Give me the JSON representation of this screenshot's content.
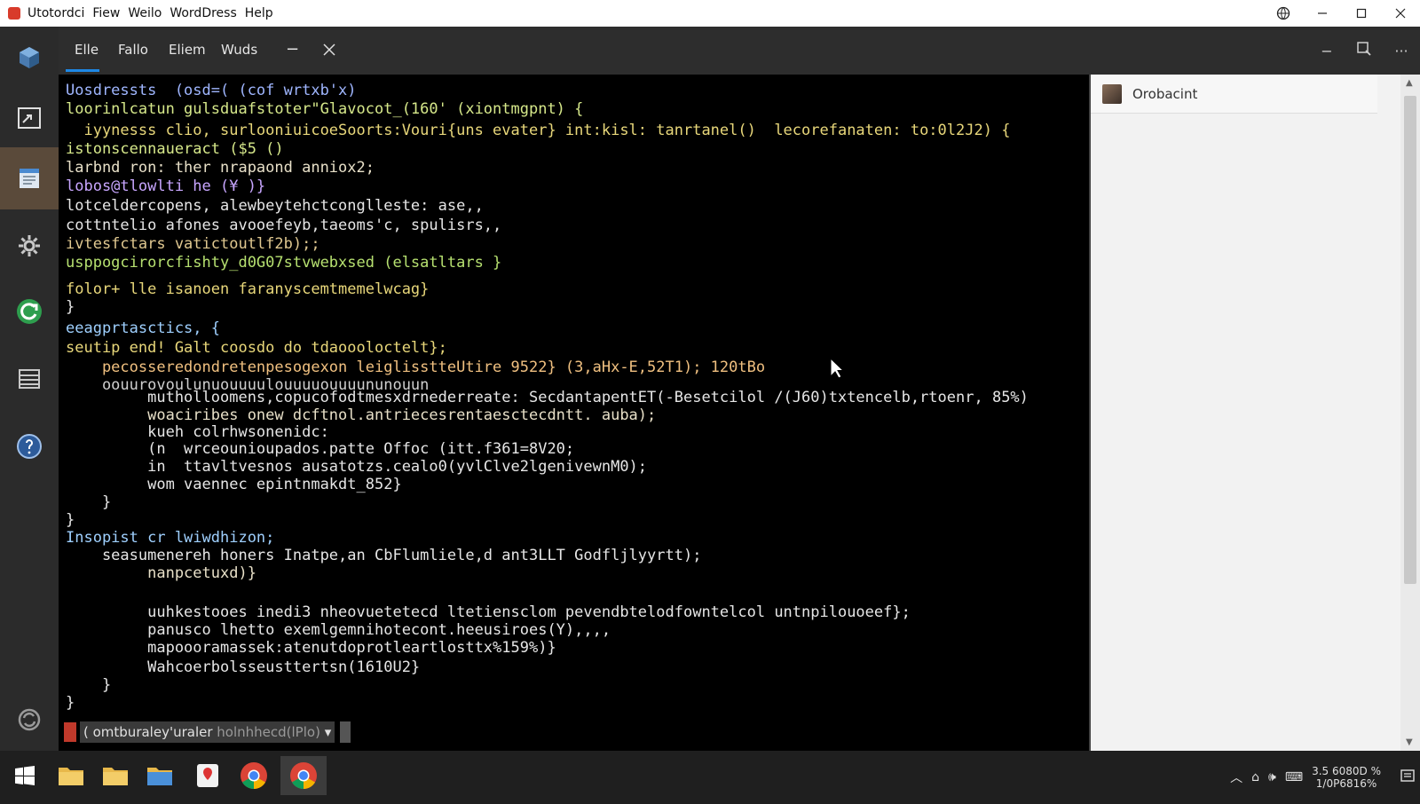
{
  "titlebar": {
    "menus": [
      "Utotordci",
      "Fiew",
      "Weilo",
      "WordDress",
      "Help"
    ]
  },
  "tabs": [
    {
      "label": "Elle"
    },
    {
      "label": "Fallo"
    },
    {
      "label": "Eliem"
    },
    {
      "label": "Wuds"
    }
  ],
  "code": [
    {
      "text": "Uosdressts  (osd=( (cof wrtxb'x)",
      "color": "#9fb6ff"
    },
    {
      "text": "loorinlcatun gulsduafstoter\"Glavocot_(160' (xiontmgpnt) {",
      "color": "#d6e88a"
    },
    {
      "text": "  iyynesss clio, surlooniuicoeSoorts:Vouri{uns evater} int:kisl: tanrtanel()  lecorefanaten: to:0l2J2) {",
      "color": "#e8d77a"
    },
    {
      "text": "istonscennaueract ($5 ()",
      "color": "#d6e88a"
    },
    {
      "text": "larbnd ron: ther nrapaond anniox2;",
      "color": "#e8e0c8"
    },
    {
      "text": "lobos@tlowlti he (¥ )}",
      "color": "#c8a6ff"
    },
    {
      "text": "lotceldercopens, alewbeytehctconglleste: ase,,",
      "color": "#e6e6e6"
    },
    {
      "text": "cottntelio afones avooefeyb,taeoms'c, spulisrs,,",
      "color": "#e6e6e6"
    },
    {
      "text": "ivtesfctars vatictoutlf2b);;",
      "color": "#e0c890"
    },
    {
      "text": "usppogcirorcfishty_d0G07stvwebxsed (elsatltars }",
      "color": "#b6e070"
    },
    {
      "text": "folor+ lle isanoen faranyscemtmemelwcag}",
      "color": "#e8d77a"
    },
    {
      "text": "}",
      "color": "#e6e6e6"
    },
    {
      "text": "eeagprtasctics, {",
      "color": "#9fd0ff"
    },
    {
      "text": "seutip end! Galt coosdo do tdaoooloctelt};",
      "color": "#e8d77a"
    },
    {
      "text": "    pecosseredondretenpesogexon leiglisstteUtire 9522} (3,aHx-E,52T1); 120tBo",
      "color": "#f0c080"
    },
    {
      "text": "    oouurovoulunuouuuulouuuuouuuununouun",
      "color": "#cfcfcf"
    },
    {
      "text": "         mutholloomens,copucofodtmesxdrnederreate: SecdantapentET(-Besetcilol /(J60)txtencelb,rtoenr, 85%)",
      "color": "#e6e6e6"
    },
    {
      "text": "         woaciribes onew dcftnol.antriecesrentaesctecdntt. auba);",
      "color": "#e8e0c8"
    },
    {
      "text": "         kueh colrhwsonenidc:",
      "color": "#e6e6e6"
    },
    {
      "text": "         (n  wrceounioupados.patte Offoc (itt.f361=8V20;",
      "color": "#e6e6e6"
    },
    {
      "text": "         in  ttavltvesnos ausatotzs.cealo0(yvlClve2lgenivewnM0);",
      "color": "#e6e6e6"
    },
    {
      "text": "         wom vaennec epintnmakdt_852}",
      "color": "#e6e6e6"
    },
    {
      "text": "    }",
      "color": "#e6e6e6"
    },
    {
      "text": "}",
      "color": "#e6e6e6"
    },
    {
      "text": "Insopist cr lwiwdhizon;",
      "color": "#9fd0ff"
    },
    {
      "text": "    seasumenereh honers Inatpe,an CbFlumliele,d ant3LLT Godfljlyyrtt);",
      "color": "#e6e6e6"
    },
    {
      "text": "         nanpcetuxd)}",
      "color": "#e8e0c8"
    },
    {
      "text": "",
      "color": "#e6e6e6"
    },
    {
      "text": "         uuhkestooes inedi3 nheovuetetecd ltetiensclom pevendbtelodfowntelcol untnpilouoeef};",
      "color": "#e6e6e6"
    },
    {
      "text": "         panusco lhetto exemlgemnihotecont.heeusiroes(Y),,,,",
      "color": "#e6e6e6"
    },
    {
      "text": "         mapoooramassek:atenutdoprotleartlosttx%159%)}",
      "color": "#e6e6e6"
    },
    {
      "text": "         Wahcoerbolsseusttertsn(1610U2}",
      "color": "#e6e6e6"
    },
    {
      "text": "    }",
      "color": "#e6e6e6"
    },
    {
      "text": "}",
      "color": "#e6e6e6"
    }
  ],
  "command": {
    "label": "( omtburaley'uraler",
    "hint": "holnhhecd(lPlo)"
  },
  "sidepanel": {
    "title": "Orobacint"
  },
  "tray": {
    "clock_line1": "3.5 6080D %",
    "clock_line2": "1/0P6816%"
  }
}
